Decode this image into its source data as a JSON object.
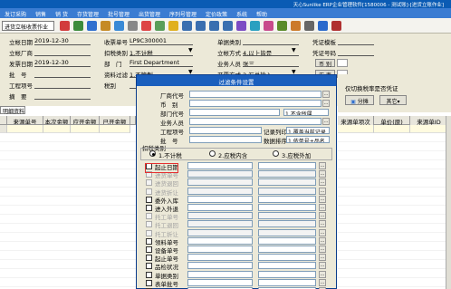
{
  "window": {
    "title": "天心Sunlike ERP企业管理软件[1580006 - 测试账]-[进货立账作业]"
  },
  "menu": [
    "发订采购",
    "销售",
    "销 货",
    "存货管理",
    "批号管理",
    "出货管理",
    "序列号管理",
    "定价政策",
    "系统",
    "帮助"
  ],
  "toolbar": {
    "combo_value": "进货立帐收票作业"
  },
  "form": {
    "left": [
      {
        "label": "立帐日期",
        "value": "2019-12-30"
      },
      {
        "label": "立帐厂商",
        "value": ""
      },
      {
        "label": "发票日期",
        "value": "2019-12-30"
      },
      {
        "label": "批　号",
        "value": ""
      },
      {
        "label": "工程项号",
        "value": ""
      },
      {
        "label": "摘　要",
        "value": ""
      }
    ],
    "mid": [
      {
        "label": "收票单号",
        "value": "LP9C300001"
      },
      {
        "label": "扣税类别",
        "value": "1.不计税"
      },
      {
        "label": "部　门",
        "value": "First Department"
      },
      {
        "label": "资料过滤",
        "value": "1.不管制"
      },
      {
        "label": "税别",
        "value": ""
      }
    ],
    "right": [
      {
        "label": "单据类别",
        "value": ""
      },
      {
        "label": "立帐方式",
        "value": "4.以上皆是"
      },
      {
        "label": "业务人员",
        "value": "张三"
      },
      {
        "label": "开票方式",
        "value": "2.汇总输入"
      }
    ],
    "far": [
      {
        "label": "凭证模板",
        "value": ""
      },
      {
        "label": "凭证号码",
        "value": ""
      }
    ],
    "mini_buttons": [
      "币 别",
      "汇 率"
    ]
  },
  "tabs": {
    "detail": "明细资料"
  },
  "grid_headers_left": [
    "",
    "来源单号",
    "本次金额",
    "应开金额",
    "已开金额"
  ],
  "grid_headers_right": [
    "来源单项次",
    "单价(原)",
    "来源单ID"
  ],
  "right_panel": {
    "link": "仅切换税率是否凭证",
    "btn_split": "分摊",
    "btn_other": "其它"
  },
  "dialog": {
    "title": "过滤条件设置",
    "fields": [
      {
        "label": "厂商代号"
      },
      {
        "label": "币　别"
      },
      {
        "label": "部门代号",
        "select": "1.不含所属"
      },
      {
        "label": "业务人员"
      },
      {
        "label": "工程项号",
        "sub_label": "记录列印",
        "select": "1.覆盖当前记录"
      },
      {
        "label": "批　号",
        "sub_label": "数据排序",
        "select": "1.依单号+品名"
      }
    ],
    "tax_group_label": "扣税类别",
    "tax_options": [
      "1.不计税",
      "2.应税内含",
      "3.应税外加"
    ],
    "tax_selected": 0,
    "date_label": "起止日期",
    "checks": [
      {
        "label": "进货单号",
        "disabled": true
      },
      {
        "label": "进货退回",
        "disabled": true
      },
      {
        "label": "进货折让",
        "disabled": true
      },
      {
        "label": "委外入库",
        "disabled": false
      },
      {
        "label": "进入外退",
        "disabled": false
      },
      {
        "label": "托工单号",
        "disabled": true
      },
      {
        "label": "托工退回",
        "disabled": true
      },
      {
        "label": "托工折让",
        "disabled": true
      },
      {
        "label": "领料单号",
        "disabled": false
      },
      {
        "label": "设备单号",
        "disabled": false
      },
      {
        "label": "起止单号",
        "disabled": false
      },
      {
        "label": "品检状况",
        "disabled": false
      },
      {
        "label": "单据类别",
        "disabled": false
      },
      {
        "label": "表单批号",
        "disabled": false
      },
      {
        "label": "仓库列示",
        "disabled": false
      }
    ]
  },
  "colors": {
    "title": "#0a5bb4",
    "menu": "#3a7cd2",
    "highlight": "#e53030"
  }
}
